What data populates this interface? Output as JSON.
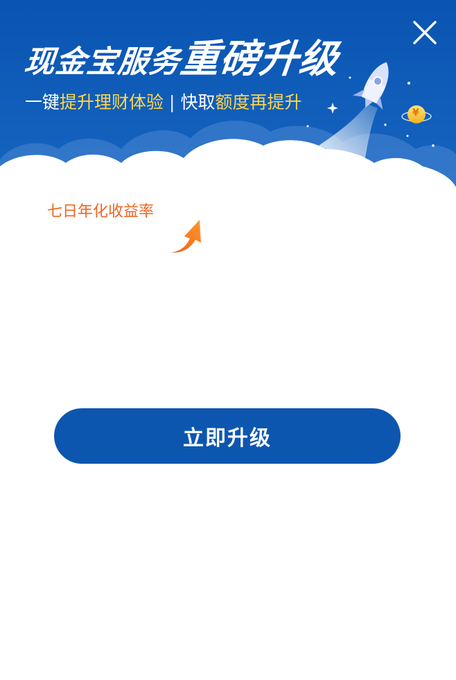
{
  "header": {
    "title_prefix": "现金宝服务",
    "title_emphasis": "重磅升级",
    "subtitle_part1": "一键",
    "subtitle_highlight1": "提升理财体验",
    "subtitle_separator": "|",
    "subtitle_part2": "快取",
    "subtitle_highlight2": "额度再提升",
    "coin_symbol": "¥"
  },
  "content": {
    "rate_label": "七日年化收益率"
  },
  "actions": {
    "upgrade_label": "立即升级"
  },
  "colors": {
    "banner_blue": "#0b56b3",
    "button_blue": "#0d56b0",
    "highlight_yellow": "#ffd54a",
    "rate_orange": "#f06422"
  },
  "icons": {
    "close": "close-icon",
    "rocket": "rocket-icon",
    "coin_planet": "coin-planet-icon",
    "arrow": "up-arrow-icon"
  }
}
